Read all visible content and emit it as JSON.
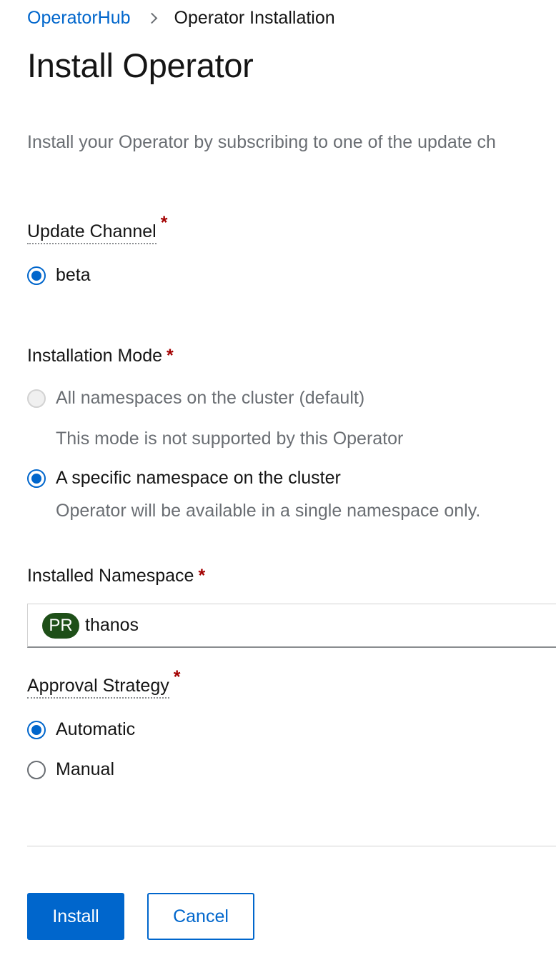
{
  "breadcrumb": {
    "parent": "OperatorHub",
    "current": "Operator Installation"
  },
  "title": "Install Operator",
  "intro": "Install your Operator by subscribing to one of the update ch",
  "update_channel": {
    "label": "Update Channel",
    "required": "*",
    "options": [
      {
        "label": "beta",
        "checked": true
      }
    ]
  },
  "installation_mode": {
    "label": "Installation Mode",
    "required": "*",
    "options": [
      {
        "label": "All namespaces on the cluster (default)",
        "checked": false,
        "disabled": true,
        "helper": "This mode is not supported by this Operator"
      },
      {
        "label": "A specific namespace on the cluster",
        "checked": true,
        "disabled": false,
        "helper": "Operator will be available in a single namespace only."
      }
    ]
  },
  "installed_namespace": {
    "label": "Installed Namespace",
    "required": "*",
    "badge": "PR",
    "value": "thanos"
  },
  "approval_strategy": {
    "label": "Approval Strategy",
    "required": "*",
    "options": [
      {
        "label": "Automatic",
        "checked": true
      },
      {
        "label": "Manual",
        "checked": false
      }
    ]
  },
  "actions": {
    "install": "Install",
    "cancel": "Cancel"
  },
  "colors": {
    "link": "#0066cc",
    "required": "#a30000",
    "namespace_badge": "#1e4f18",
    "muted_text": "#6a6e73"
  }
}
